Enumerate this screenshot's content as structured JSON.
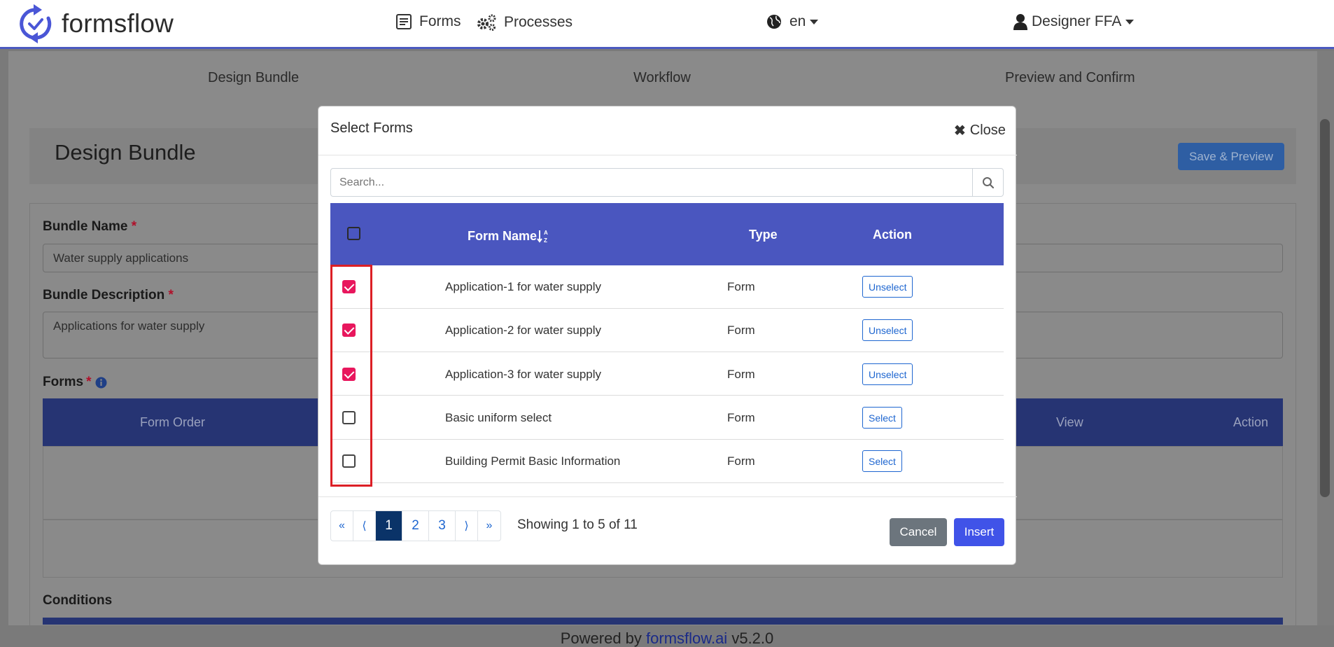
{
  "navbar": {
    "brand": "formsflow",
    "forms": "Forms",
    "processes": "Processes",
    "language": "en",
    "user": "Designer FFA"
  },
  "steps": [
    "Design Bundle",
    "Workflow",
    "Preview and Confirm"
  ],
  "page": {
    "title": "Design Bundle",
    "save_preview": "Save & Preview",
    "bundle_name_label": "Bundle Name",
    "bundle_name_value": "Water supply applications",
    "bundle_desc_label": "Bundle Description",
    "bundle_desc_value": "Applications for water supply",
    "forms_label": "Forms",
    "required_mark": "*",
    "forms_table": {
      "form_order": "Form Order",
      "view": "View",
      "action": "Action"
    },
    "conditions_label": "Conditions"
  },
  "modal": {
    "title": "Select Forms",
    "close": "Close",
    "search_placeholder": "Search...",
    "columns": {
      "form_name": "Form Name",
      "type": "Type",
      "action": "Action"
    },
    "rows": [
      {
        "name": "Application-1 for water supply",
        "type": "Form",
        "action": "Unselect",
        "checked": true
      },
      {
        "name": "Application-2 for water supply",
        "type": "Form",
        "action": "Unselect",
        "checked": true
      },
      {
        "name": "Application-3 for water supply",
        "type": "Form",
        "action": "Unselect",
        "checked": true
      },
      {
        "name": "Basic uniform select",
        "type": "Form",
        "action": "Select",
        "checked": false
      },
      {
        "name": "Building Permit Basic Information",
        "type": "Form",
        "action": "Select",
        "checked": false
      }
    ],
    "pagination": {
      "first": "«",
      "prev": "⟨",
      "pages": [
        "1",
        "2",
        "3"
      ],
      "active_page": "1",
      "next": "⟩",
      "last": "»",
      "showing": "Showing 1 to 5 of 11"
    },
    "cancel": "Cancel",
    "insert": "Insert"
  },
  "footer": {
    "prefix": "Powered by",
    "link": "formsflow.ai",
    "version": "v5.2.0"
  },
  "colors": {
    "primary": "#4a56bf",
    "checkbox_checked": "#e8175d",
    "highlight_box": "#dc1f26",
    "insert_button": "#4053e8",
    "cancel_button": "#6c757d"
  }
}
